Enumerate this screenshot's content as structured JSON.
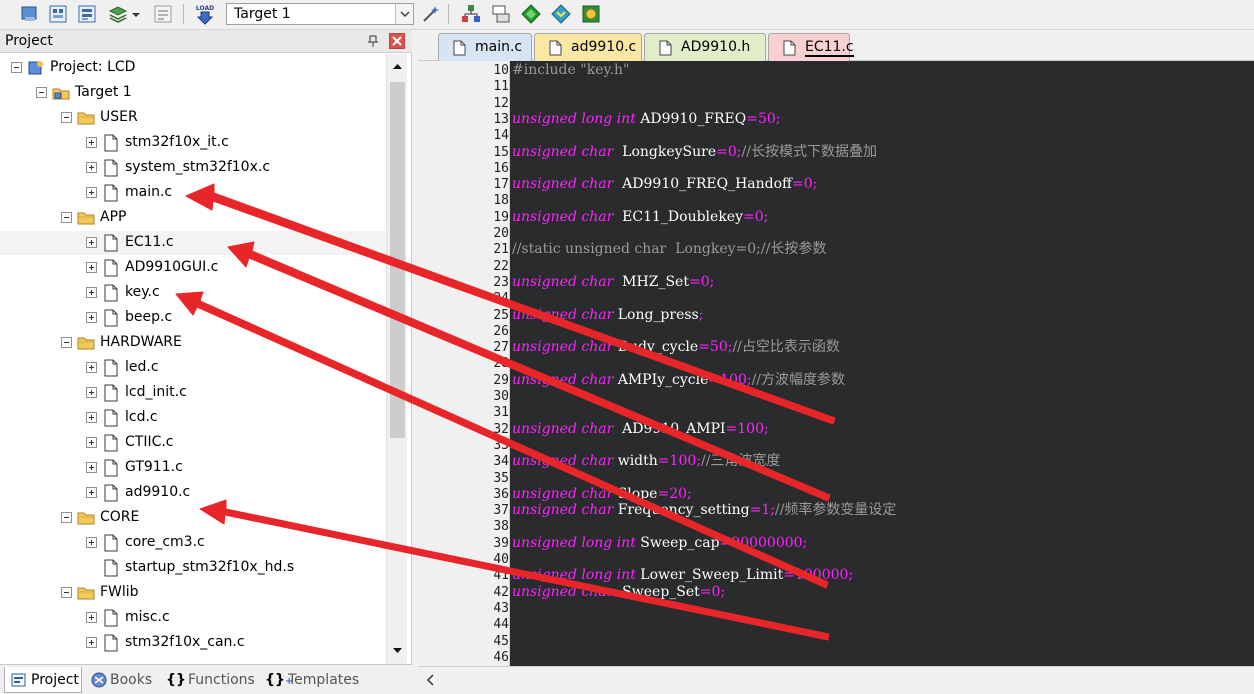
{
  "toolbar": {
    "target_select_value": "Target 1",
    "icons": [
      "options-icon",
      "batch-build-icon",
      "rebuild-icon",
      "manage-components-icon",
      "dropdown-arrow-icon",
      "select-packs-icon",
      "load-icon",
      "magic-wand-icon",
      "pack-installer-icon",
      "layout-icon",
      "green-diamond-icon",
      "arrow-diamond-icon",
      "sphere-icon"
    ],
    "load_label": "LOAD"
  },
  "project_panel": {
    "title": "Project",
    "tree": [
      {
        "label": "Project: LCD",
        "level": 0,
        "type": "project",
        "expanded": true
      },
      {
        "label": "Target 1",
        "level": 1,
        "type": "target",
        "expanded": true
      },
      {
        "label": "USER",
        "level": 2,
        "type": "folder",
        "expanded": true
      },
      {
        "label": "stm32f10x_it.c",
        "level": 3,
        "type": "file",
        "expandable": true
      },
      {
        "label": "system_stm32f10x.c",
        "level": 3,
        "type": "file",
        "expandable": true
      },
      {
        "label": "main.c",
        "level": 3,
        "type": "file",
        "expandable": true
      },
      {
        "label": "APP",
        "level": 2,
        "type": "folder",
        "expanded": true
      },
      {
        "label": "EC11.c",
        "level": 3,
        "type": "file",
        "expandable": true,
        "highlighted": true
      },
      {
        "label": "AD9910GUI.c",
        "level": 3,
        "type": "file",
        "expandable": true
      },
      {
        "label": "key.c",
        "level": 3,
        "type": "file",
        "expandable": true
      },
      {
        "label": "beep.c",
        "level": 3,
        "type": "file",
        "expandable": true
      },
      {
        "label": "HARDWARE",
        "level": 2,
        "type": "folder",
        "expanded": true
      },
      {
        "label": "led.c",
        "level": 3,
        "type": "file",
        "expandable": true
      },
      {
        "label": "lcd_init.c",
        "level": 3,
        "type": "file",
        "expandable": true
      },
      {
        "label": "lcd.c",
        "level": 3,
        "type": "file",
        "expandable": true
      },
      {
        "label": "CTIIC.c",
        "level": 3,
        "type": "file",
        "expandable": true
      },
      {
        "label": "GT911.c",
        "level": 3,
        "type": "file",
        "expandable": true
      },
      {
        "label": "ad9910.c",
        "level": 3,
        "type": "file",
        "expandable": true
      },
      {
        "label": "CORE",
        "level": 2,
        "type": "folder",
        "expanded": true
      },
      {
        "label": "core_cm3.c",
        "level": 3,
        "type": "file",
        "expandable": true
      },
      {
        "label": "startup_stm32f10x_hd.s",
        "level": 3,
        "type": "file",
        "expandable": false
      },
      {
        "label": "FWlib",
        "level": 2,
        "type": "folder",
        "expanded": true
      },
      {
        "label": "misc.c",
        "level": 3,
        "type": "file",
        "expandable": true
      },
      {
        "label": "stm32f10x_can.c",
        "level": 3,
        "type": "file",
        "expandable": true
      }
    ]
  },
  "bottom_tabs": [
    {
      "label": "Project",
      "active": true
    },
    {
      "label": "Books",
      "active": false
    },
    {
      "label": "Functions",
      "active": false
    },
    {
      "label": "Templates",
      "active": false
    }
  ],
  "editor_tabs": [
    {
      "label": "main.c",
      "active": false,
      "color": "#d7e4f3"
    },
    {
      "label": "ad9910.c",
      "active": false,
      "color": "#fbe7a4"
    },
    {
      "label": "AD9910.h",
      "active": false,
      "color": "#dfeec9"
    },
    {
      "label": "EC11.c",
      "active": true,
      "color": "#f7d1d1"
    }
  ],
  "code_lines": [
    {
      "n": "10",
      "tokens": [
        [
          "pp",
          "#include "
        ],
        [
          "str",
          "\"key.h\""
        ]
      ]
    },
    {
      "n": "11",
      "tokens": []
    },
    {
      "n": "12",
      "tokens": []
    },
    {
      "n": "13",
      "tokens": [
        [
          "kw",
          "unsigned long int "
        ],
        [
          "id",
          "AD9910_FREQ"
        ],
        [
          "pc",
          "="
        ],
        [
          "num",
          "50"
        ],
        [
          "pc",
          ";"
        ]
      ]
    },
    {
      "n": "14",
      "tokens": []
    },
    {
      "n": "15",
      "tokens": [
        [
          "kw",
          "unsigned char  "
        ],
        [
          "id",
          "LongkeySure"
        ],
        [
          "pc",
          "="
        ],
        [
          "num",
          "0"
        ],
        [
          "pc",
          ";"
        ],
        [
          "cm",
          "//长按模式下数据叠加"
        ]
      ]
    },
    {
      "n": "16",
      "tokens": []
    },
    {
      "n": "17",
      "tokens": [
        [
          "kw",
          "unsigned char  "
        ],
        [
          "id",
          "AD9910_FREQ_Handoff"
        ],
        [
          "pc",
          "="
        ],
        [
          "num",
          "0"
        ],
        [
          "pc",
          ";"
        ]
      ]
    },
    {
      "n": "18",
      "tokens": []
    },
    {
      "n": "19",
      "tokens": [
        [
          "kw",
          "unsigned char  "
        ],
        [
          "id",
          "EC11_Doublekey"
        ],
        [
          "pc",
          "="
        ],
        [
          "num",
          "0"
        ],
        [
          "pc",
          ";"
        ]
      ]
    },
    {
      "n": "20",
      "tokens": []
    },
    {
      "n": "21",
      "tokens": [
        [
          "cm",
          "//static unsigned char  Longkey=0;//长按参数"
        ]
      ]
    },
    {
      "n": "22",
      "tokens": []
    },
    {
      "n": "23",
      "tokens": [
        [
          "kw",
          "unsigned char  "
        ],
        [
          "id",
          "MHZ_Set"
        ],
        [
          "pc",
          "="
        ],
        [
          "num",
          "0"
        ],
        [
          "pc",
          ";"
        ]
      ]
    },
    {
      "n": "24",
      "tokens": []
    },
    {
      "n": "25",
      "tokens": [
        [
          "kw",
          "unsigned char "
        ],
        [
          "id",
          "Long_press"
        ],
        [
          "pc",
          ";"
        ]
      ]
    },
    {
      "n": "26",
      "tokens": []
    },
    {
      "n": "27",
      "tokens": [
        [
          "kw",
          "unsigned char "
        ],
        [
          "id",
          "Dudy_cycle"
        ],
        [
          "pc",
          "="
        ],
        [
          "num",
          "50"
        ],
        [
          "pc",
          ";"
        ],
        [
          "cm",
          "//占空比表示函数"
        ]
      ]
    },
    {
      "n": "28",
      "tokens": []
    },
    {
      "n": "29",
      "tokens": [
        [
          "kw",
          "unsigned char "
        ],
        [
          "id",
          "AMPIy_cycle"
        ],
        [
          "pc",
          "="
        ],
        [
          "num",
          "100"
        ],
        [
          "pc",
          ";"
        ],
        [
          "cm",
          "//方波幅度参数"
        ]
      ]
    },
    {
      "n": "30",
      "tokens": []
    },
    {
      "n": "31",
      "tokens": []
    },
    {
      "n": "32",
      "tokens": [
        [
          "kw",
          "unsigned char  "
        ],
        [
          "id",
          "AD9910_AMPI"
        ],
        [
          "pc",
          "="
        ],
        [
          "num",
          "100"
        ],
        [
          "pc",
          ";"
        ]
      ]
    },
    {
      "n": "33",
      "tokens": []
    },
    {
      "n": "34",
      "tokens": [
        [
          "kw",
          "unsigned char "
        ],
        [
          "id",
          "width"
        ],
        [
          "pc",
          "="
        ],
        [
          "num",
          "100"
        ],
        [
          "pc",
          ";"
        ],
        [
          "cm",
          "//三角波宽度"
        ]
      ]
    },
    {
      "n": "35",
      "tokens": []
    },
    {
      "n": "36",
      "tokens": [
        [
          "kw",
          "unsigned char "
        ],
        [
          "id",
          "Slope"
        ],
        [
          "pc",
          "="
        ],
        [
          "num",
          "20"
        ],
        [
          "pc",
          ";"
        ]
      ]
    },
    {
      "n": "37",
      "tokens": [
        [
          "kw",
          "unsigned char "
        ],
        [
          "id",
          "Frequency_setting"
        ],
        [
          "pc",
          "="
        ],
        [
          "num",
          "1"
        ],
        [
          "pc",
          ";"
        ],
        [
          "cm",
          "//频率参数变量设定"
        ]
      ]
    },
    {
      "n": "38",
      "tokens": []
    },
    {
      "n": "39",
      "tokens": [
        [
          "kw",
          "unsigned long int "
        ],
        [
          "id",
          "Sweep_cap"
        ],
        [
          "pc",
          "="
        ],
        [
          "num",
          "90000000"
        ],
        [
          "pc",
          ";"
        ]
      ]
    },
    {
      "n": "40",
      "tokens": []
    },
    {
      "n": "41",
      "tokens": [
        [
          "kw",
          "unsigned long int "
        ],
        [
          "id",
          "Lower_Sweep_Limit"
        ],
        [
          "pc",
          "="
        ],
        [
          "num",
          "100000"
        ],
        [
          "pc",
          ";"
        ]
      ]
    },
    {
      "n": "42",
      "tokens": [
        [
          "kw",
          "unsigned char  "
        ],
        [
          "id",
          "Sweep_Set"
        ],
        [
          "pc",
          "="
        ],
        [
          "num",
          "0"
        ],
        [
          "pc",
          ";"
        ]
      ]
    },
    {
      "n": "43",
      "tokens": []
    },
    {
      "n": "44",
      "tokens": []
    },
    {
      "n": "45",
      "tokens": []
    },
    {
      "n": "46",
      "tokens": []
    }
  ],
  "annotation_arrows": [
    {
      "from": "main.c",
      "to": "line-27"
    },
    {
      "from": "AD9910GUI.c",
      "to": "line-36"
    },
    {
      "from": "key.c",
      "to": "line-41"
    },
    {
      "from": "ad9910.c",
      "to": "line-46"
    }
  ],
  "colors": {
    "editor_bg": "#2a2b2c",
    "keyword": "#ff22ff",
    "comment": "#9a9a9a",
    "arrow": "#e8262a"
  }
}
